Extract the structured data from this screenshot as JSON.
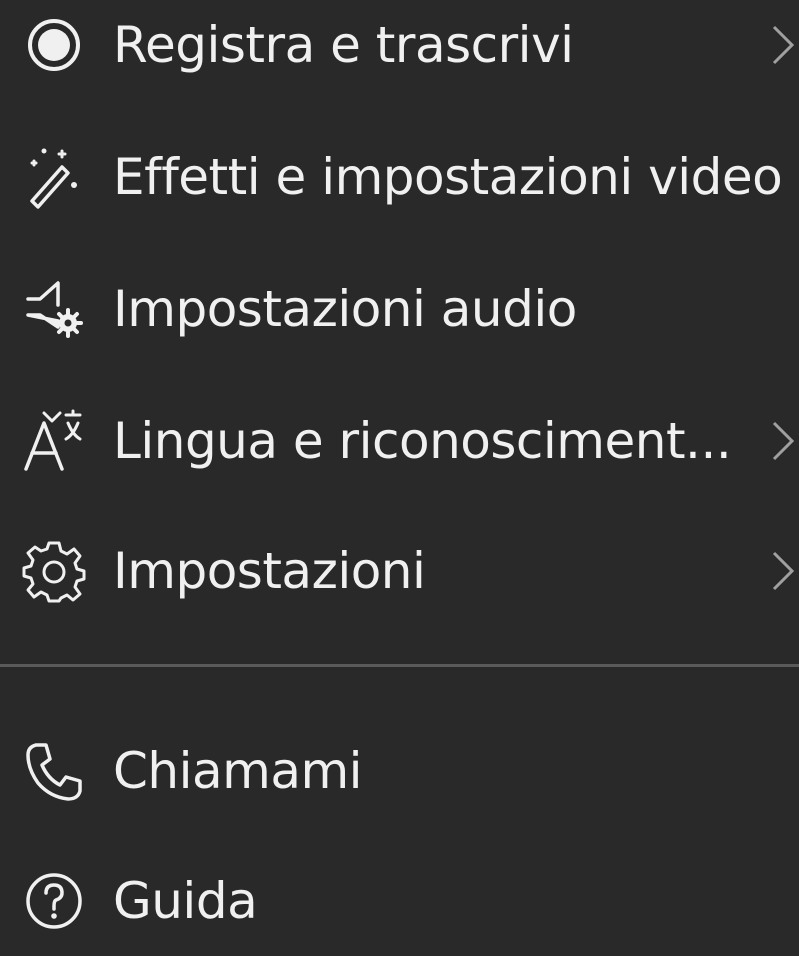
{
  "menu": {
    "items": [
      {
        "label": "Registra e trascrivi",
        "icon": "record-icon",
        "has_submenu": true
      },
      {
        "label": "Effetti e impostazioni video",
        "icon": "magic-wand-icon",
        "has_submenu": false
      },
      {
        "label": "Impostazioni audio",
        "icon": "speaker-gear-icon",
        "has_submenu": false
      },
      {
        "label": "Lingua e riconosciment...",
        "icon": "language-icon",
        "has_submenu": true
      },
      {
        "label": "Impostazioni",
        "icon": "gear-icon",
        "has_submenu": true
      }
    ],
    "bottom_items": [
      {
        "label": "Chiamami",
        "icon": "phone-icon"
      },
      {
        "label": "Guida",
        "icon": "help-icon"
      }
    ]
  },
  "colors": {
    "background": "#292929",
    "text": "#f0f0f0",
    "divider": "#5a5a5a",
    "chevron": "#a0a0a0"
  }
}
